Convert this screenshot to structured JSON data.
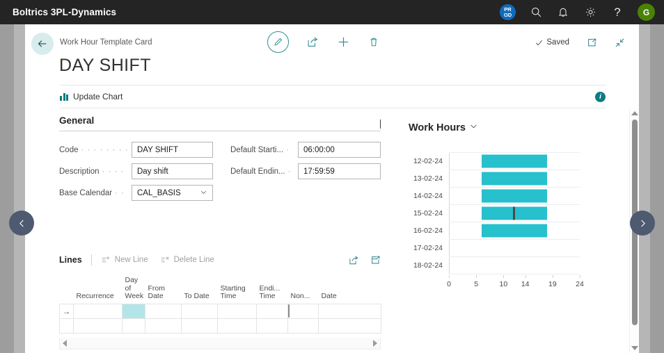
{
  "appbar": {
    "title": "Boltrics 3PL-Dynamics",
    "env_badge_top": "PR",
    "env_badge_bottom": "OD",
    "search_icon": "search-icon",
    "notifications_icon": "bell-icon",
    "settings_icon": "gear-icon",
    "help_icon": "question-mark-icon",
    "help_glyph": "?",
    "avatar_initial": "G"
  },
  "header": {
    "back_icon": "back-arrow-icon",
    "breadcrumb": "Work Hour Template Card",
    "page_title": "DAY SHIFT",
    "edit_icon": "pencil-icon",
    "share_icon": "share-icon",
    "new_icon": "plus-icon",
    "delete_icon": "trash-icon",
    "saved_label": "Saved",
    "saved_check_icon": "checkmark-icon",
    "open_new_window_icon": "open-in-new-window-icon",
    "collapse_icon": "collapse-arrows-icon"
  },
  "actionbar": {
    "update_chart_label": "Update Chart",
    "chart_icon": "bar-chart-icon",
    "info_icon": "info-icon",
    "info_glyph": "i"
  },
  "general": {
    "section_title": "General",
    "fields": [
      {
        "label": "Code",
        "dots": "· · · · · · · · ·",
        "value": "DAY SHIFT",
        "name": "code-field"
      },
      {
        "label": "Description",
        "dots": "· · · ·",
        "value": "Day shift",
        "name": "description-field"
      },
      {
        "label": "Base Calendar",
        "dots": "· ·",
        "value": "CAL_BASIS",
        "name": "base-calendar-dropdown"
      },
      {
        "label": "Default Starti...",
        "dots": "·",
        "value": "06:00:00",
        "name": "default-starting-time-field"
      },
      {
        "label": "Default Endin...",
        "dots": "·",
        "value": "17:59:59",
        "name": "default-ending-time-field"
      }
    ]
  },
  "lines": {
    "title": "Lines",
    "new_line_label": "New Line",
    "new_line_icon": "new-line-icon",
    "delete_line_label": "Delete Line",
    "delete_line_icon": "delete-line-icon",
    "share_icon": "share-icon",
    "open_excel_icon": "open-in-excel-icon",
    "columns": [
      "Recurrence",
      "Day of Week",
      "From Date",
      "To Date",
      "Starting Time",
      "Endi... Time",
      "Non...",
      "Date"
    ],
    "rows": [
      {
        "indicator": "→",
        "recurrence": "",
        "day_of_week": "",
        "from_date": "",
        "to_date": "",
        "starting_time": "",
        "ending_time": "",
        "non_working": "",
        "date": "",
        "selected_cell": "day_of_week",
        "has_checkbox": true
      },
      {
        "indicator": "",
        "recurrence": "",
        "day_of_week": "",
        "from_date": "",
        "to_date": "",
        "starting_time": "",
        "ending_time": "",
        "non_working": "",
        "date": "",
        "selected_cell": "",
        "has_checkbox": false
      }
    ],
    "scroll_left_icon": "scroll-left-arrow-icon",
    "scroll_right_icon": "scroll-right-arrow-icon"
  },
  "chart_panel": {
    "title": "Work Hours",
    "collapse_icon": "chevron-down-icon"
  },
  "chart_data": {
    "type": "bar",
    "orientation": "horizontal",
    "title": "Work Hours",
    "xlabel": "",
    "ylabel": "",
    "categories": [
      "12-02-24",
      "13-02-24",
      "14-02-24",
      "15-02-24",
      "16-02-24",
      "17-02-24",
      "18-02-24"
    ],
    "series": [
      {
        "name": "Work Hours",
        "color": "#27c0cd",
        "ranges": [
          {
            "category": "12-02-24",
            "start": 6,
            "end": 18
          },
          {
            "category": "13-02-24",
            "start": 6,
            "end": 18
          },
          {
            "category": "14-02-24",
            "start": 6,
            "end": 18
          },
          {
            "category": "15-02-24",
            "start": 6,
            "end": 18
          },
          {
            "category": "16-02-24",
            "start": 6,
            "end": 18
          },
          {
            "category": "17-02-24",
            "start": 0,
            "end": 0
          },
          {
            "category": "18-02-24",
            "start": 0,
            "end": 0
          }
        ]
      }
    ],
    "markers": [
      {
        "category": "15-02-24",
        "value": 11.8,
        "color": "#4a4a4a"
      }
    ],
    "xlim": [
      0,
      24
    ],
    "xticks": [
      0,
      5,
      10,
      14,
      19,
      24
    ],
    "xtick_labels": [
      "0",
      "5",
      "10",
      "14",
      "19",
      "24"
    ],
    "grid": true,
    "legend": false
  },
  "scrollbar": {
    "up_icon": "scroll-up-arrow-icon",
    "down_icon": "scroll-down-arrow-icon"
  },
  "sidenav": {
    "prev_icon": "chevron-left-icon",
    "next_icon": "chevron-right-icon"
  },
  "colors": {
    "accent_teal": "#2d8d96",
    "chart_bar": "#27c0cd",
    "appbar_bg": "#242424",
    "badge_blue": "#0f6cbd",
    "avatar_green": "#498205",
    "selected_cell": "#b3e5e8"
  }
}
